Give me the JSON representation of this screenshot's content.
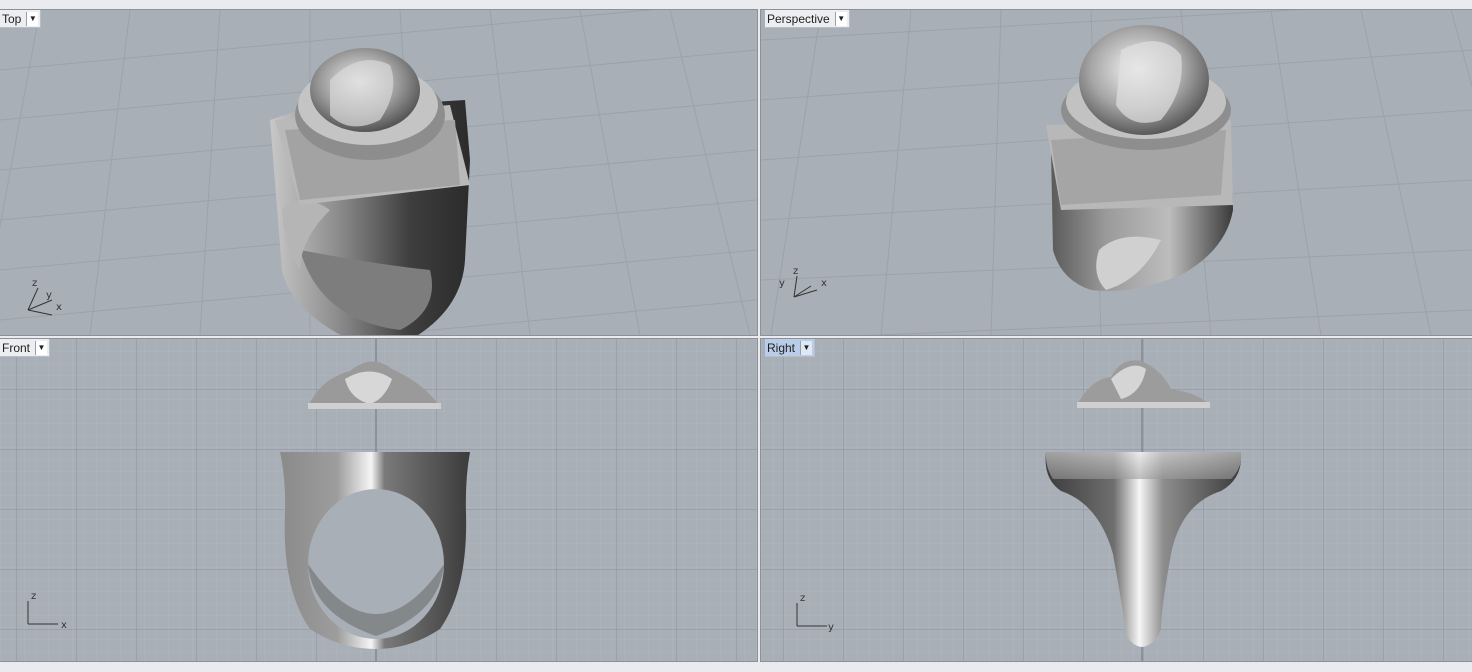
{
  "viewports": {
    "top": {
      "title": "Top",
      "axes": {
        "a": "z",
        "b": "y",
        "c": "x"
      }
    },
    "perspective": {
      "title": "Perspective",
      "axes": {
        "a": "z",
        "b": "y",
        "c": "x"
      }
    },
    "front": {
      "title": "Front",
      "axes": {
        "a": "z",
        "c": "x"
      }
    },
    "right": {
      "title": "Right",
      "axes": {
        "a": "z",
        "c": "y"
      }
    }
  },
  "active_viewport": "Right",
  "colors": {
    "viewport_bg": "#a9afb7",
    "grid_minor": "#b7bcc4",
    "grid_major": "#8d939c",
    "model_light": "#eeeeee",
    "model_dark": "#4a4a4a"
  }
}
